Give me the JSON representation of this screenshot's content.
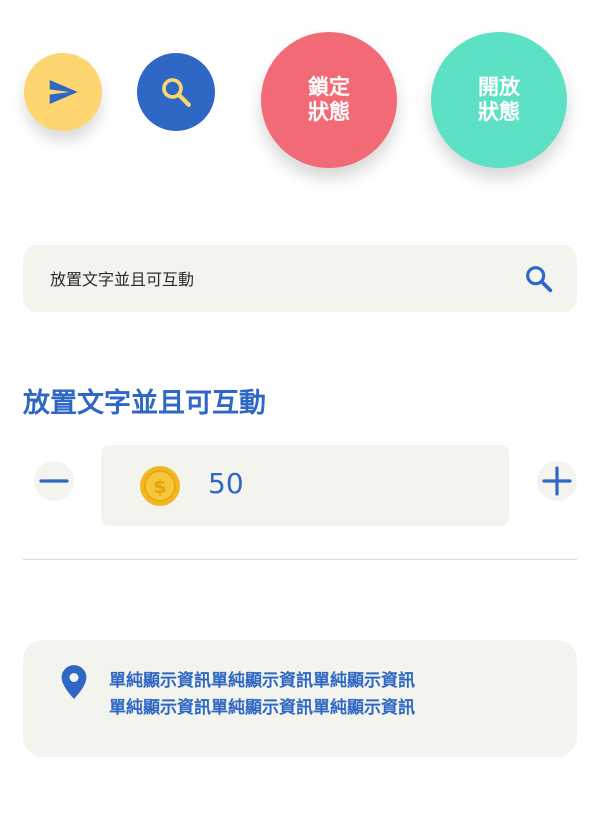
{
  "buttons": {
    "send": {
      "icon": "send-icon",
      "color": "#FDD670"
    },
    "search": {
      "icon": "search-icon",
      "color": "#2F67C4"
    },
    "lock": {
      "line1": "鎖定",
      "line2": "狀態",
      "color": "#F36A77"
    },
    "open": {
      "line1": "開放",
      "line2": "狀態",
      "color": "#5CE1C4"
    }
  },
  "search": {
    "text": "放置文字並且可互動",
    "icon": "search-icon"
  },
  "section": {
    "heading": "放置文字並且可互動"
  },
  "stepper": {
    "value": "50",
    "coin_icon": "dollar-coin-icon",
    "minus_icon": "minus-icon",
    "plus_icon": "plus-icon"
  },
  "info": {
    "icon": "location-pin-icon",
    "line1": "單純顯示資訊單純顯示資訊單純顯示資訊",
    "line2": "單純顯示資訊單純顯示資訊單純顯示資訊"
  },
  "colors": {
    "primary": "#2F67C4",
    "surface": "#F4F4EF",
    "accent_yellow": "#FDD670",
    "coin": "#F2B621"
  }
}
